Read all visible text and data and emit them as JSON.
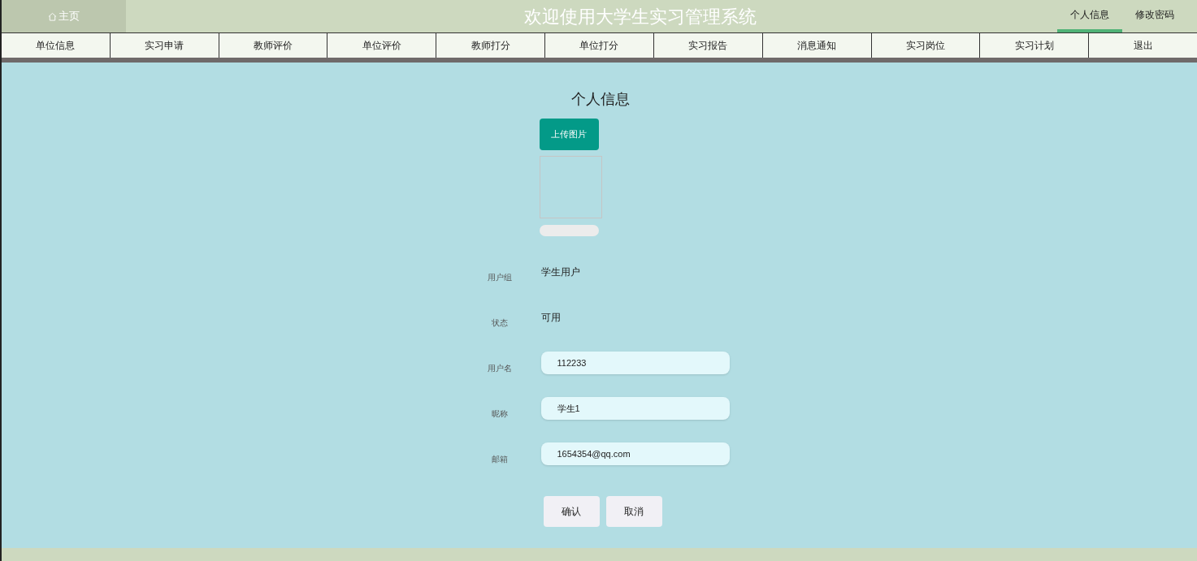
{
  "header": {
    "home_link": "主页",
    "title": "欢迎使用大学生实习管理系统",
    "tabs": [
      {
        "label": "个人信息",
        "selected": true
      },
      {
        "label": "修改密码",
        "selected": false
      }
    ]
  },
  "nav": [
    "单位信息",
    "实习申请",
    "教师评价",
    "单位评价",
    "教师打分",
    "单位打分",
    "实习报告",
    "消息通知",
    "实习岗位",
    "实习计划",
    "退出"
  ],
  "page": {
    "title": "个人信息",
    "upload_button": "上传图片",
    "fields": [
      {
        "kind": "text",
        "label": "用户组",
        "value": "学生用户"
      },
      {
        "kind": "text",
        "label": "状态",
        "value": "可用"
      },
      {
        "kind": "input",
        "label": "用户名",
        "value": "112233"
      },
      {
        "kind": "input",
        "label": "昵称",
        "value": "学生1"
      },
      {
        "kind": "input",
        "label": "邮箱",
        "value": "1654354@qq.com"
      }
    ],
    "buttons": [
      "确认",
      "取消"
    ]
  }
}
